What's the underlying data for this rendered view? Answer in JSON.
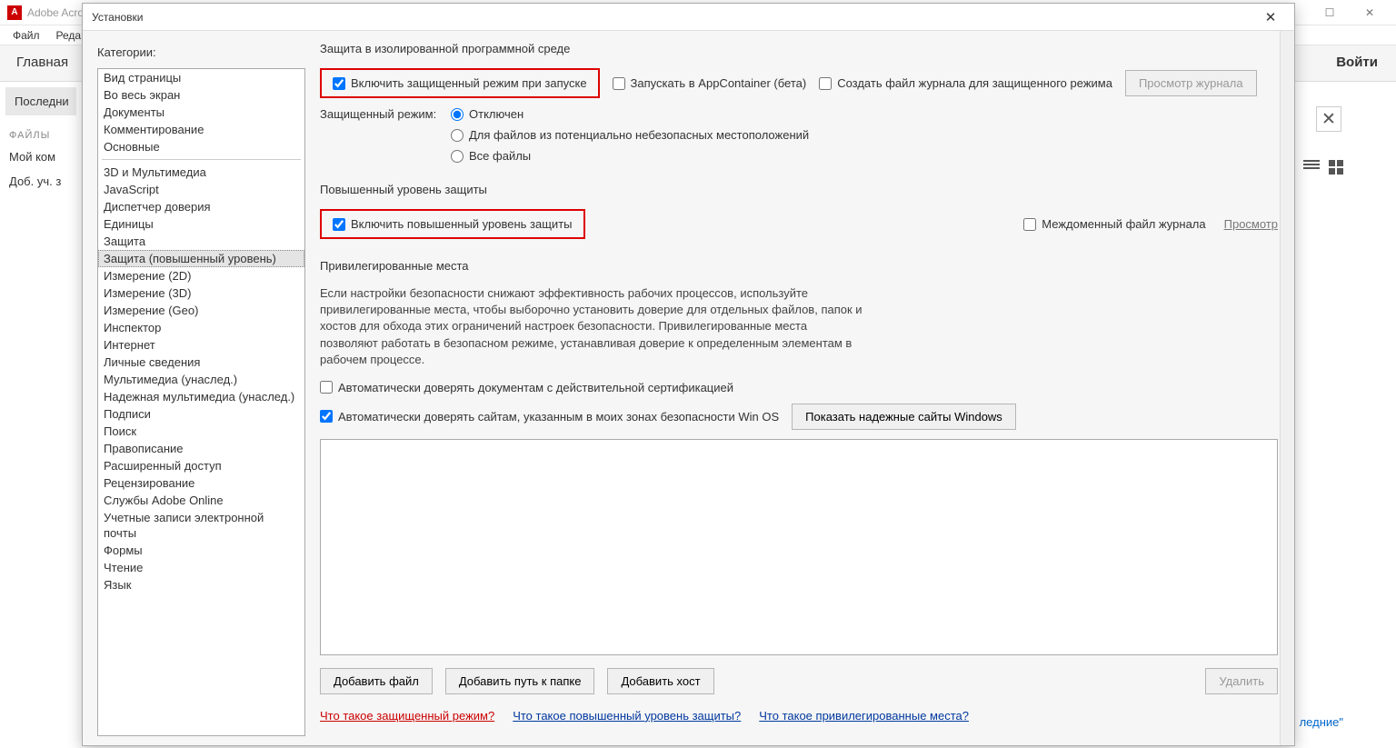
{
  "app": {
    "title": "Adobe Acro",
    "menus": [
      "Файл",
      "Редакти"
    ],
    "tabs": {
      "home": "Главная"
    },
    "signin": "Войти",
    "recent_pill": "Последни",
    "files_label": "ФАЙЛЫ",
    "my_computer": "Мой ком",
    "add_account": "Доб. уч. з",
    "recent_link": "ледние\""
  },
  "dialog": {
    "title": "Установки",
    "categories_label": "Категории:",
    "cat_group1": [
      "Вид страницы",
      "Во весь экран",
      "Документы",
      "Комментирование",
      "Основные"
    ],
    "cat_group2": [
      "3D и Мультимедиа",
      "JavaScript",
      "Диспетчер доверия",
      "Единицы",
      "Защита",
      "Защита (повышенный уровень)",
      "Измерение (2D)",
      "Измерение (3D)",
      "Измерение (Geo)",
      "Инспектор",
      "Интернет",
      "Личные сведения",
      "Мультимедиа (унаслед.)",
      "Надежная мультимедиа (унаслед.)",
      "Подписи",
      "Поиск",
      "Правописание",
      "Расширенный доступ",
      "Рецензирование",
      "Службы Adobe Online",
      "Учетные записи электронной почты",
      "Формы",
      "Чтение",
      "Язык"
    ],
    "selected_category": "Защита (повышенный уровень)",
    "sec1": {
      "title": "Защита в изолированной программной среде",
      "enable_protected": "Включить защищенный режим при запуске",
      "appcontainer": "Запускать в AppContainer (бета)",
      "create_log": "Создать файл журнала для защищенного режима",
      "view_log_btn": "Просмотр журнала",
      "mode_label": "Защищенный режим:",
      "radios": [
        "Отключен",
        "Для файлов из потенциально небезопасных местоположений",
        "Все файлы"
      ]
    },
    "sec2": {
      "title": "Повышенный уровень защиты",
      "enable_enhanced": "Включить повышенный уровень защиты",
      "crossdomain": "Междоменный файл журнала",
      "browse": "Просмотр"
    },
    "sec3": {
      "title": "Привилегированные места",
      "desc": "Если настройки безопасности снижают эффективность рабочих процессов, используйте привилегированные места, чтобы выборочно установить доверие для отдельных файлов, папок и хостов для обхода этих ограничений настроек безопасности. Привилегированные места позволяют работать в безопасном режиме, устанавливая доверие к определенным элементам в рабочем процессе.",
      "auto_trust_cert": "Автоматически доверять документам с действительной сертификацией",
      "auto_trust_os": "Автоматически доверять сайтам, указанным в моих зонах безопасности Win OS",
      "show_trusted_btn": "Показать надежные сайты Windows",
      "add_file": "Добавить файл",
      "add_folder": "Добавить путь к папке",
      "add_host": "Добавить хост",
      "delete": "Удалить"
    },
    "links": {
      "protected": "Что такое защищенный режим?",
      "enhanced": "Что такое повышенный уровень защиты?",
      "privileged": "Что такое привилегированные места?"
    }
  }
}
